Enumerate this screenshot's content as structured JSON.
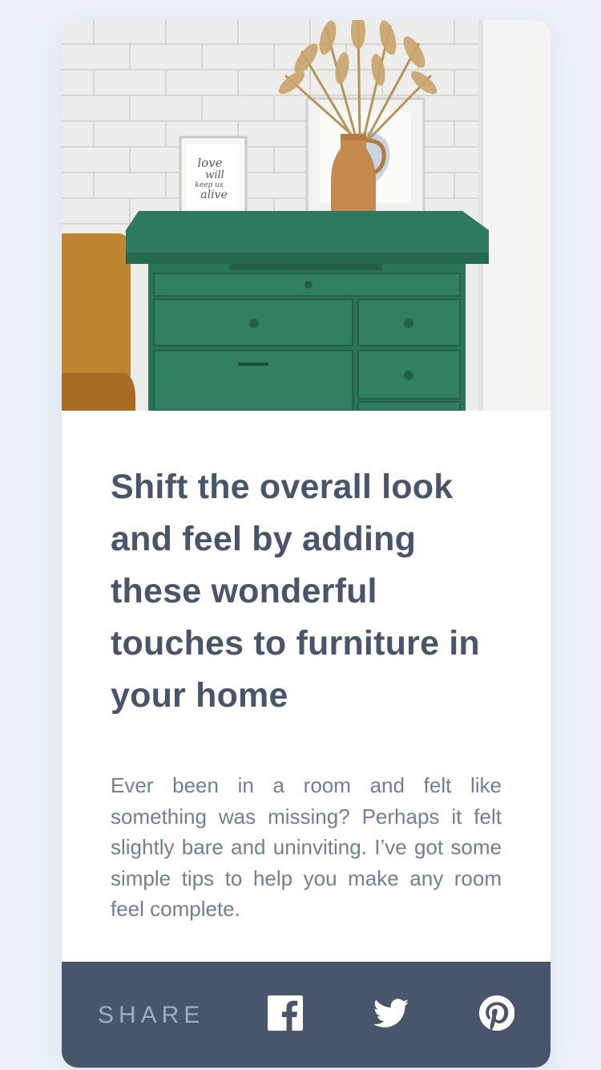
{
  "article": {
    "title": "Shift the overall look and feel by adding these wonderful touches to furniture in your home",
    "description": "Ever been in a room and felt like something was missing? Perhaps it felt slightly bare and uninviting. I’ve got some simple tips to help you make any room feel complete.",
    "image_alt": "Green dresser with framed art and dried grass in a vase",
    "frame_text": [
      "love",
      "will",
      "keep us",
      "alive"
    ]
  },
  "share": {
    "label": "SHARE",
    "icons": [
      "facebook-icon",
      "twitter-icon",
      "pinterest-icon"
    ]
  },
  "colors": {
    "page_bg": "#ECF2F8",
    "card_bg": "#FFFFFF",
    "title": "#48556A",
    "body": "#6E8098",
    "share_bar": "#48556A",
    "share_label": "#9DAEC2",
    "icon": "#FFFFFF"
  }
}
